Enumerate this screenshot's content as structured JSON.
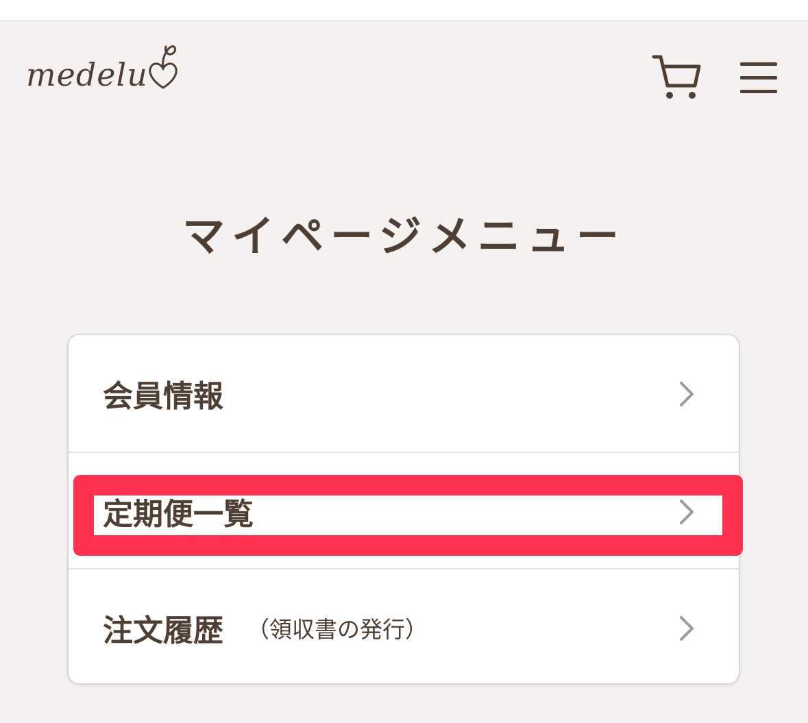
{
  "header": {
    "logo_text": "medelu",
    "cart_icon": "cart-icon",
    "menu_icon": "hamburger-menu-icon"
  },
  "page": {
    "title": "マイページメニュー"
  },
  "menu": {
    "items": [
      {
        "label": "会員情報",
        "sub": "",
        "icon": "chevron-right-icon"
      },
      {
        "label": "定期便一覧",
        "sub": "",
        "icon": "chevron-right-icon"
      },
      {
        "label": "注文履歴",
        "sub": "（領収書の発行）",
        "icon": "chevron-right-icon"
      }
    ]
  },
  "colors": {
    "background": "#f5f1f0",
    "text": "#4f3e34",
    "highlight": "#ff334f",
    "chevron": "#9a9aa2"
  }
}
